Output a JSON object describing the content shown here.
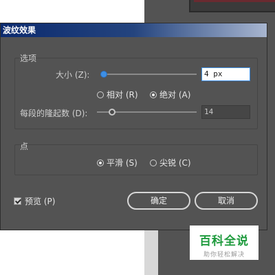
{
  "dialog": {
    "title": "波纹效果"
  },
  "options": {
    "group_label": "选项",
    "size_label": "大小 (Z):",
    "size_value": "4 px",
    "size_slider_fraction": 0.0,
    "relative_label": "相对 (R)",
    "absolute_label": "绝对 (A)",
    "selected_mode": "absolute",
    "ridges_label": "每段的隆起数 (D):",
    "ridges_value": "14",
    "ridges_slider_fraction": 0.18
  },
  "points": {
    "group_label": "点",
    "smooth_label": "平滑 (S)",
    "corner_label": "尖锐 (C)",
    "selected": "smooth"
  },
  "preview": {
    "label": "预览 (P)",
    "checked": true
  },
  "buttons": {
    "ok_label": "确定",
    "cancel_label": "取消"
  },
  "watermark": {
    "logo_text": "百科全说",
    "subtitle": "助你轻松解决"
  },
  "colors": {
    "dialog_bg": "#535353",
    "accent_blue": "#3d8fe6",
    "watermark_green": "#1f9b3e"
  }
}
